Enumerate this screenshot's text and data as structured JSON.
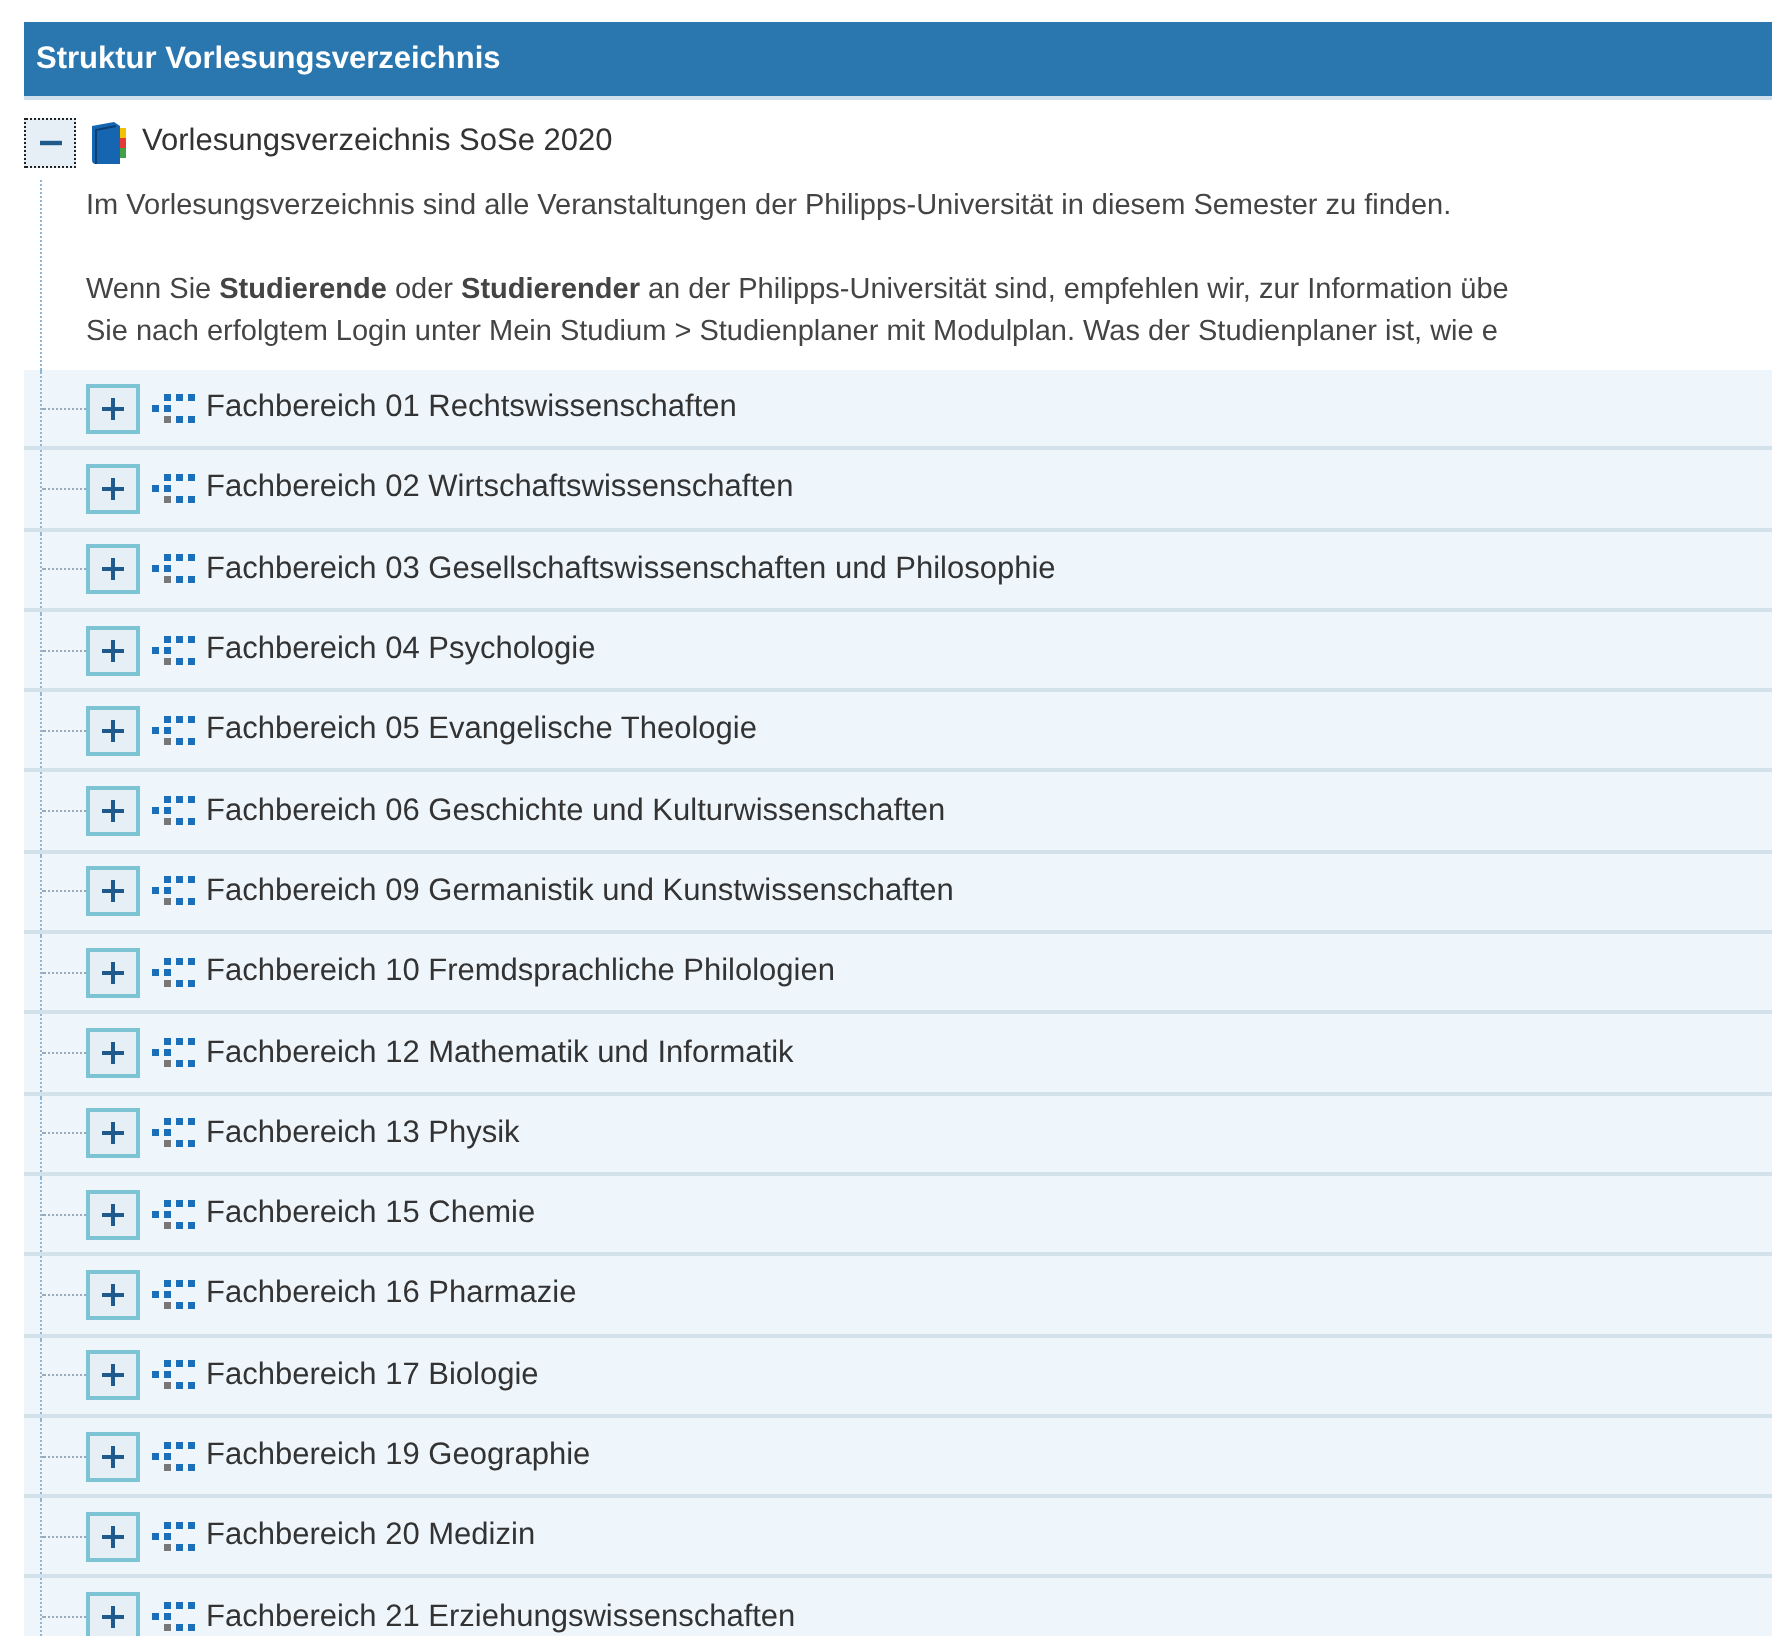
{
  "panel": {
    "title": "Struktur Vorlesungsverzeichnis"
  },
  "tree": {
    "label": "Vorlesungsverzeichnis SoSe 2020",
    "expanded": true,
    "description": [
      {
        "lines": [
          "Im Vorlesungsverzeichnis sind alle Veranstaltungen der Philipps-Universität in diesem Semester zu finden."
        ]
      },
      {
        "lines": [
          "Wenn Sie **Studierende** oder **Studierender** an der Philipps-Universität sind, empfehlen wir, zur Information übe",
          "Sie nach erfolgtem Login unter Mein Studium > Studienplaner mit Modulplan. Was der Studienplaner ist, wie e"
        ]
      }
    ],
    "children": [
      {
        "label": "Fachbereich 01 Rechtswissenschaften",
        "expanded": false
      },
      {
        "label": "Fachbereich 02 Wirtschaftswissenschaften",
        "expanded": false
      },
      {
        "label": "Fachbereich 03 Gesellschaftswissenschaften und Philosophie",
        "expanded": false
      },
      {
        "label": "Fachbereich 04 Psychologie",
        "expanded": false
      },
      {
        "label": "Fachbereich 05 Evangelische Theologie",
        "expanded": false
      },
      {
        "label": "Fachbereich 06 Geschichte und Kulturwissenschaften",
        "expanded": false
      },
      {
        "label": "Fachbereich 09 Germanistik und Kunstwissenschaften",
        "expanded": false
      },
      {
        "label": "Fachbereich 10 Fremdsprachliche Philologien",
        "expanded": false
      },
      {
        "label": "Fachbereich 12 Mathematik und Informatik",
        "expanded": false
      },
      {
        "label": "Fachbereich 13 Physik",
        "expanded": false
      },
      {
        "label": "Fachbereich 15 Chemie",
        "expanded": false
      },
      {
        "label": "Fachbereich 16 Pharmazie",
        "expanded": false
      },
      {
        "label": "Fachbereich 17 Biologie",
        "expanded": false
      },
      {
        "label": "Fachbereich 19 Geographie",
        "expanded": false
      },
      {
        "label": "Fachbereich 20 Medizin",
        "expanded": false
      },
      {
        "label": "Fachbereich 21 Erziehungswissenschaften",
        "expanded": false
      }
    ]
  }
}
